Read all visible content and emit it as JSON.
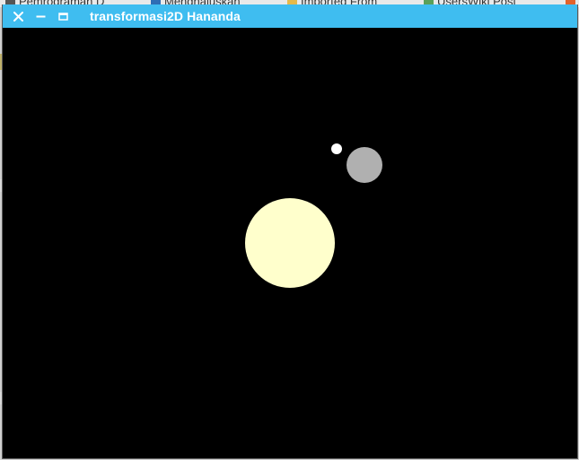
{
  "background_tabs": [
    {
      "label": "Pemrograman D",
      "icon": "globe-icon",
      "color": "#555555"
    },
    {
      "label": "Menghaluskan",
      "icon": "globe-icon",
      "color": "#2e6db4"
    },
    {
      "label": "Imported From",
      "icon": "folder-icon",
      "color": "#e6b94a"
    },
    {
      "label": "UsersWiki Post",
      "icon": "puzzle-icon",
      "color": "#5aa05a"
    }
  ],
  "window": {
    "title": "transformasi2D Hananda",
    "titlebar_color": "#3fbdf0",
    "canvas_color": "#000000",
    "controls": {
      "close": "close-icon",
      "minimize": "minimize-icon",
      "maximize": "maximize-icon"
    }
  },
  "scene": {
    "sun": {
      "color": "#ffffcc"
    },
    "planet": {
      "color": "#b0b0b0"
    },
    "moon": {
      "color": "#ffffff"
    }
  }
}
